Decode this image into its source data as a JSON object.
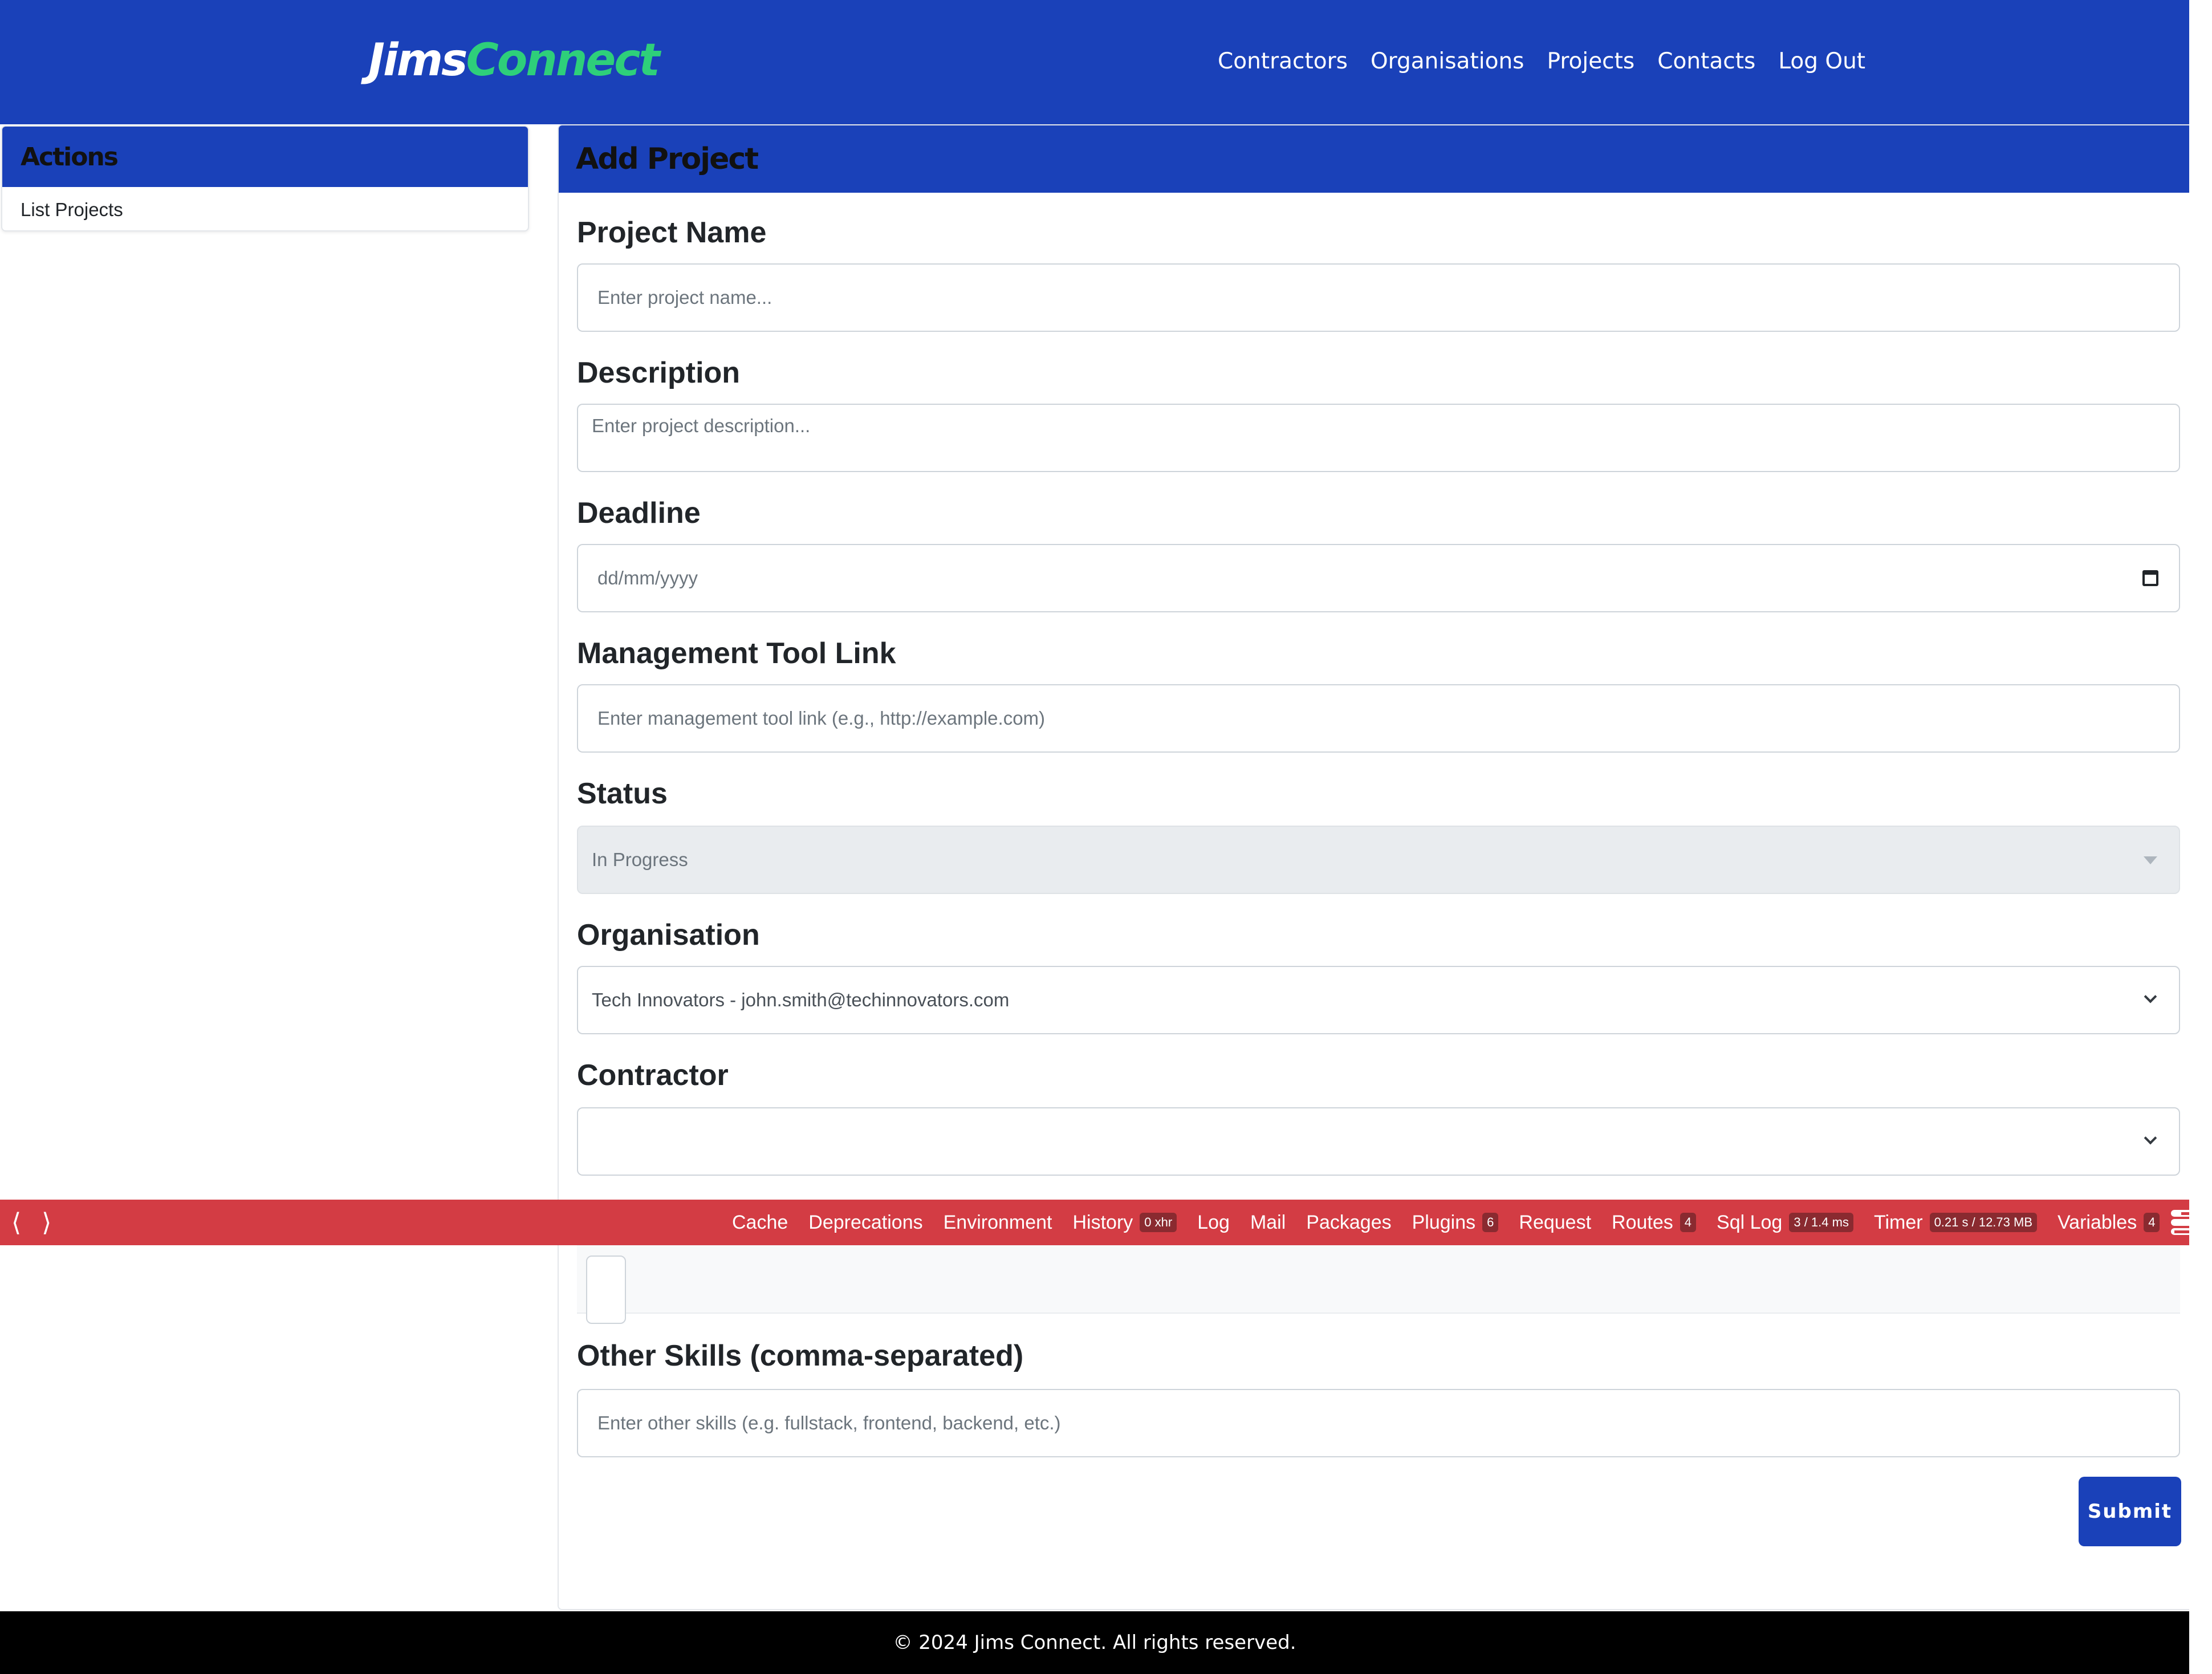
{
  "header": {
    "logo_part1": "Jims",
    "logo_part2": "Connect",
    "nav": [
      "Contractors",
      "Organisations",
      "Projects",
      "Contacts",
      "Log Out"
    ]
  },
  "sidebar": {
    "title": "Actions",
    "links": [
      "List Projects"
    ]
  },
  "form": {
    "title": "Add Project",
    "project_name": {
      "label": "Project Name",
      "placeholder": "Enter project name..."
    },
    "description": {
      "label": "Description",
      "placeholder": "Enter project description..."
    },
    "deadline": {
      "label": "Deadline",
      "placeholder": "dd/mm/yyyy"
    },
    "management_link": {
      "label": "Management Tool Link",
      "placeholder": "Enter management tool link (e.g., http://example.com)"
    },
    "status": {
      "label": "Status",
      "value": "In Progress"
    },
    "organisation": {
      "label": "Organisation",
      "value": "Tech Innovators - john.smith@techinnovators.com"
    },
    "contractor": {
      "label": "Contractor",
      "value": ""
    },
    "other_skills": {
      "label": "Other Skills (comma-separated)",
      "placeholder": "Enter other skills (e.g. fullstack, frontend, backend, etc.)"
    },
    "submit_label": "Submit"
  },
  "debugbar": {
    "items": [
      {
        "label": "Cache",
        "badge": ""
      },
      {
        "label": "Deprecations",
        "badge": ""
      },
      {
        "label": "Environment",
        "badge": ""
      },
      {
        "label": "History",
        "badge": "0 xhr"
      },
      {
        "label": "Log",
        "badge": ""
      },
      {
        "label": "Mail",
        "badge": ""
      },
      {
        "label": "Packages",
        "badge": ""
      },
      {
        "label": "Plugins",
        "badge": "6"
      },
      {
        "label": "Request",
        "badge": ""
      },
      {
        "label": "Routes",
        "badge": "4"
      },
      {
        "label": "Sql Log",
        "badge": "3 / 1.4 ms"
      },
      {
        "label": "Timer",
        "badge": "0.21 s / 12.73 MB"
      },
      {
        "label": "Variables",
        "badge": "4"
      }
    ],
    "colors": {
      "bar": "#d33c44"
    }
  },
  "footer": {
    "text": "© 2024 Jims Connect. All rights reserved."
  },
  "colors": {
    "brand": "#1a41b9",
    "logo_accent": "#2ecf7a"
  }
}
